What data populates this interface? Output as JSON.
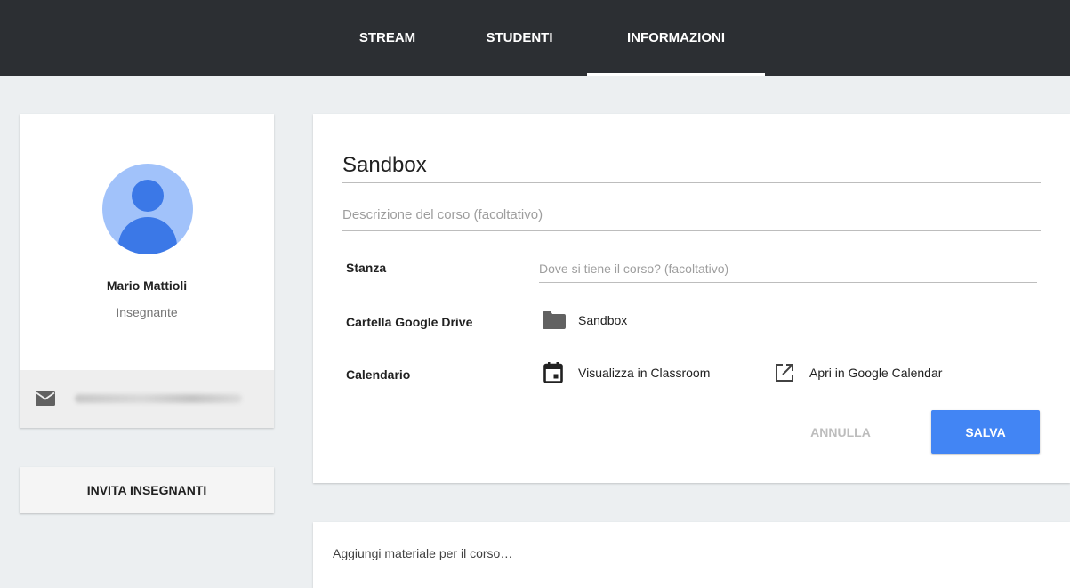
{
  "nav": {
    "tabs": [
      {
        "label": "STREAM"
      },
      {
        "label": "STUDENTI"
      },
      {
        "label": "INFORMAZIONI",
        "active": true
      }
    ]
  },
  "profile": {
    "name": "Mario Mattioli",
    "role": "Insegnante",
    "avatar_icon": "person-icon",
    "email_icon": "mail-icon"
  },
  "invite": {
    "label": "INVITA INSEGNANTI"
  },
  "course": {
    "title": "Sandbox",
    "description_placeholder": "Descrizione del corso (facoltativo)",
    "room_label": "Stanza",
    "room_placeholder": "Dove si tiene il corso? (facoltativo)",
    "drive_label": "Cartella Google Drive",
    "drive_folder": "Sandbox",
    "calendar_label": "Calendario",
    "view_in_classroom": "Visualizza in Classroom",
    "open_in_calendar": "Apri in Google Calendar",
    "cancel_label": "ANNULLA",
    "save_label": "SALVA"
  },
  "material": {
    "placeholder": "Aggiungi materiale per il corso…"
  },
  "colors": {
    "topbar": "#2c2f33",
    "accent": "#4285f4",
    "avatar_bg": "#a1c2fa",
    "avatar_fg": "#3b78e7"
  }
}
